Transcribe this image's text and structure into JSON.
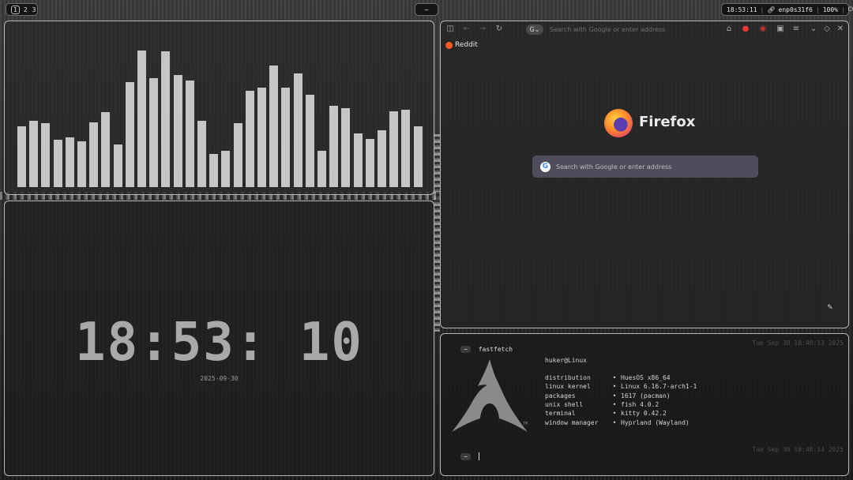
{
  "topbar": {
    "workspaces": [
      "1",
      "2",
      "3"
    ],
    "active_workspace": "1",
    "center_label": "~",
    "status": {
      "time": "18:53:11",
      "network": "enp0s31f6",
      "volume": "100%",
      "power_icon": "power-icon"
    }
  },
  "visualizer": {
    "bar_levels": [
      0.44,
      0.48,
      0.46,
      0.34,
      0.36,
      0.33,
      0.47,
      0.54,
      0.31,
      0.76,
      0.99,
      0.79,
      0.98,
      0.81,
      0.77,
      0.48,
      0.24,
      0.26,
      0.46,
      0.7,
      0.72,
      0.88,
      0.72,
      0.82,
      0.67,
      0.26,
      0.59,
      0.57,
      0.39,
      0.35,
      0.41,
      0.55,
      0.56,
      0.44
    ]
  },
  "clock": {
    "time": "18:53: 10",
    "date": "2025-09-30"
  },
  "browser": {
    "url_placeholder": "Search with Google or enter address",
    "bookmark": "Reddit",
    "brand": "Firefox",
    "search_placeholder": "Search with Google or enter address",
    "google_glyph": "G"
  },
  "terminal": {
    "prompt_symbol": "~",
    "command": "fastfetch",
    "timestamp1": "Tue Sep 30 18:48:13 2025",
    "user_host": "huker@Linux",
    "info": [
      {
        "key": "distribution",
        "value": "HuesOS x86_64"
      },
      {
        "key": "linux kernel",
        "value": "Linux 6.16.7-arch1-1"
      },
      {
        "key": "packages",
        "value": "1617 (pacman)"
      },
      {
        "key": "unix shell",
        "value": "fish 4.0.2"
      },
      {
        "key": "terminal",
        "value": "kitty 0.42.2"
      },
      {
        "key": "window manager",
        "value": "Hyprland (Wayland)"
      }
    ],
    "bullet": "•",
    "tm": "TM",
    "timestamp2": "Tue Sep 30 18:48:14 2025"
  }
}
